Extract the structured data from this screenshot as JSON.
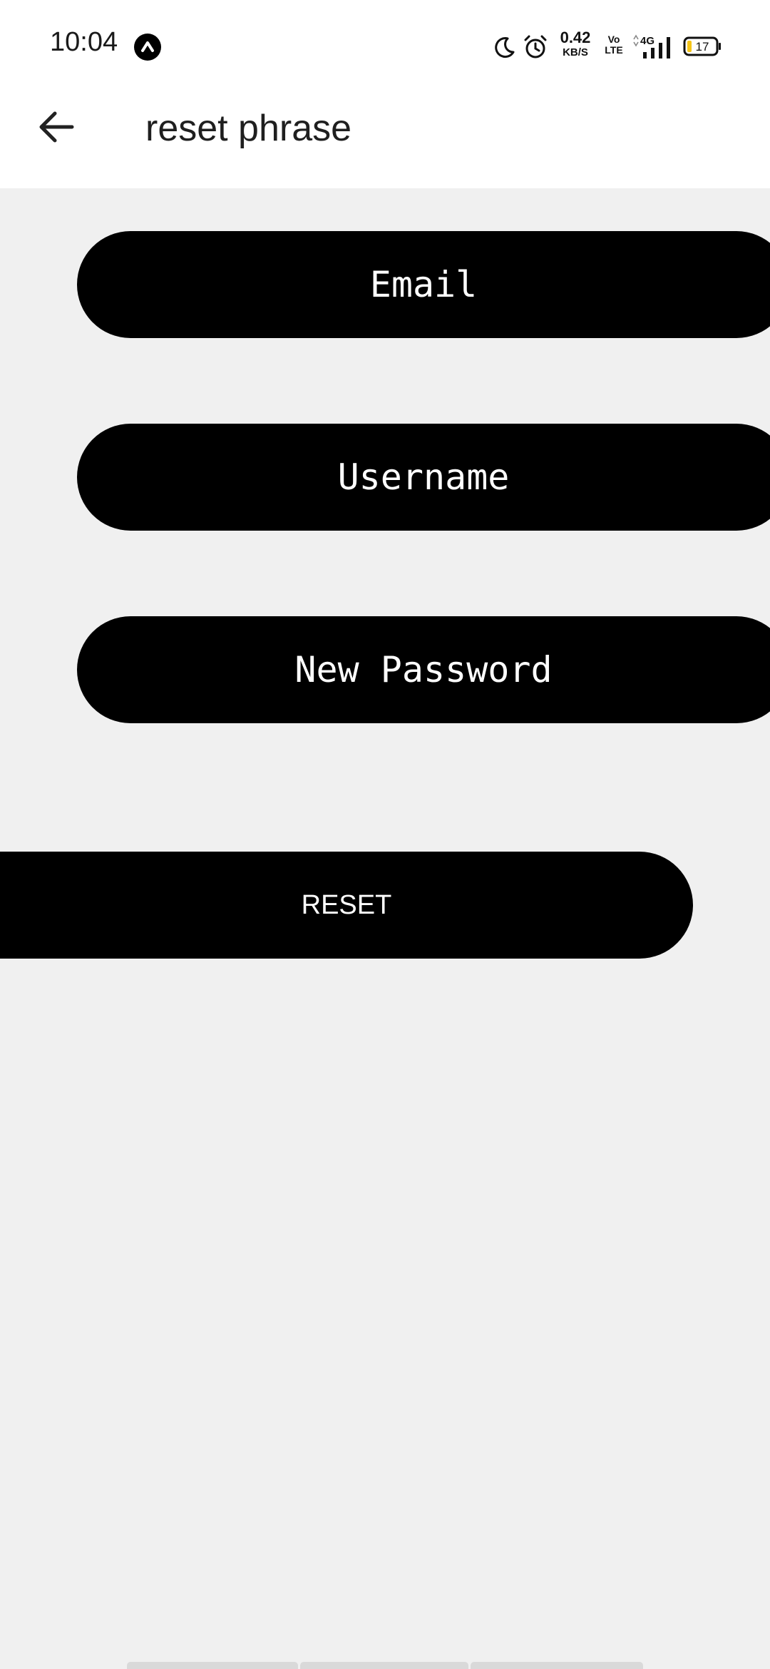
{
  "status_bar": {
    "time": "10:04",
    "net_speed_value": "0.42",
    "net_speed_unit": "KB/S",
    "volte_top": "Vo",
    "volte_bottom": "LTE",
    "network_type": "4G",
    "battery_level": "17",
    "icons": [
      "app-notification-icon",
      "do-not-disturb-moon-icon",
      "alarm-clock-icon",
      "signal-strength-icon",
      "battery-icon"
    ]
  },
  "app_bar": {
    "back_icon": "arrow-left-icon",
    "title": "reset phrase"
  },
  "form": {
    "email_placeholder": "Email",
    "username_placeholder": "Username",
    "new_password_placeholder": "New Password",
    "reset_label": "RESET"
  },
  "colors": {
    "background": "#f0f0f0",
    "app_bar": "#ffffff",
    "field_fill": "#000000",
    "field_text": "#ffffff",
    "battery_fill": "#f5c518"
  }
}
